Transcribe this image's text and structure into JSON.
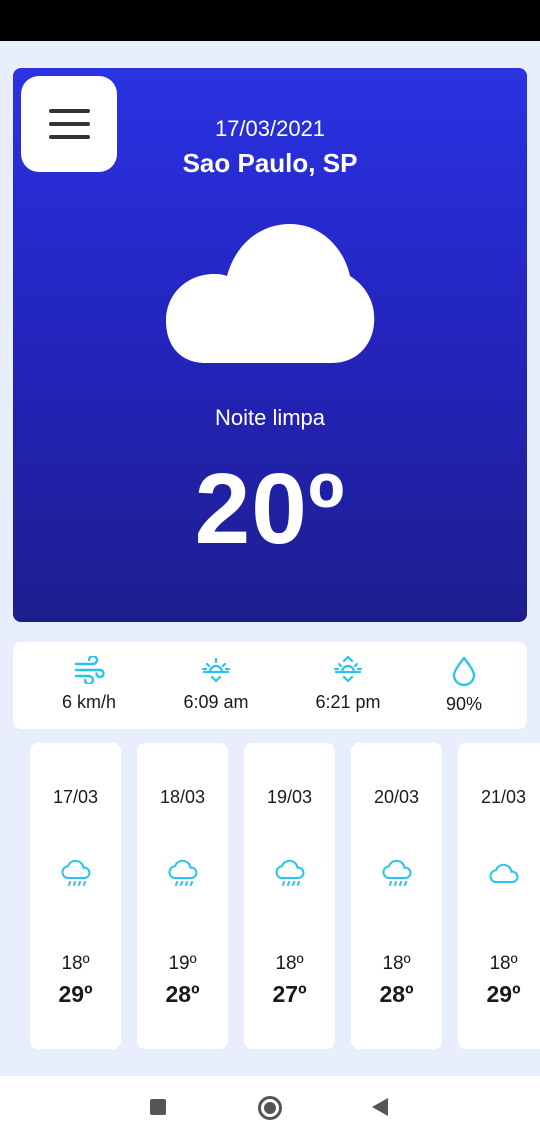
{
  "current": {
    "date": "17/03/2021",
    "city": "Sao Paulo, SP",
    "description": "Noite limpa",
    "temperature": "20º",
    "icon": "cloud-icon"
  },
  "stats": [
    {
      "icon": "wind-icon",
      "value": "6 km/h"
    },
    {
      "icon": "sunrise-icon",
      "value": "6:09 am"
    },
    {
      "icon": "sunset-icon",
      "value": "6:21 pm"
    },
    {
      "icon": "humidity-drop-icon",
      "value": "90%"
    }
  ],
  "forecast": [
    {
      "date": "17/03",
      "icon": "rain-cloud-icon",
      "min": "18º",
      "max": "29º"
    },
    {
      "date": "18/03",
      "icon": "rain-cloud-icon",
      "min": "19º",
      "max": "28º"
    },
    {
      "date": "19/03",
      "icon": "rain-cloud-icon",
      "min": "18º",
      "max": "27º"
    },
    {
      "date": "20/03",
      "icon": "rain-cloud-icon",
      "min": "18º",
      "max": "28º"
    },
    {
      "date": "21/03",
      "icon": "cloud-icon",
      "min": "18º",
      "max": "29º"
    }
  ],
  "colors": {
    "hero_top": "#2a32e2",
    "hero_bottom": "#1d1e8e",
    "accent_cyan": "#27c4ee",
    "background": "#e8eefb"
  }
}
